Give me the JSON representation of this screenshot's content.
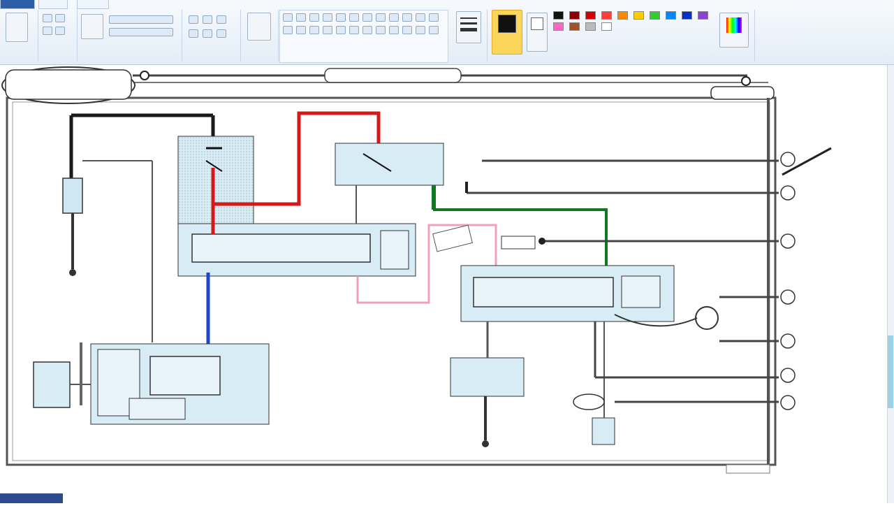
{
  "ribbon": {
    "tabs": [
      "",
      "",
      ""
    ],
    "groups": [
      "",
      "",
      "",
      "",
      "",
      "",
      ""
    ],
    "colors": [
      "#111111",
      "#8b0000",
      "#d40000",
      "#ff3c3c",
      "#ff8800",
      "#ffcc00",
      "#33cc33",
      "#0088ff",
      "#0033cc",
      "#8844cc",
      "#ff66cc",
      "#a0522d",
      "#bbbbbb",
      "#ffffff"
    ],
    "active_tool": "wire-tool"
  },
  "diagram": {
    "wire_colors": {
      "black": "#1a1a1a",
      "red": "#d11a1a",
      "green": "#0f7a1f",
      "blue": "#1f45c8",
      "pink": "#f2a0b8",
      "gray": "#555555",
      "component_fill": "#d8ecf6"
    },
    "labels": {
      "title_box": "",
      "bus_top": "",
      "bus_right": "",
      "mid_tag": "",
      "connector_a": "",
      "connector_b": "",
      "connector_c": "",
      "connector_d": "",
      "connector_e": "",
      "connector_f": "",
      "connector_g": "",
      "ground_a": "",
      "ground_b": "",
      "bottom_right": ""
    }
  }
}
